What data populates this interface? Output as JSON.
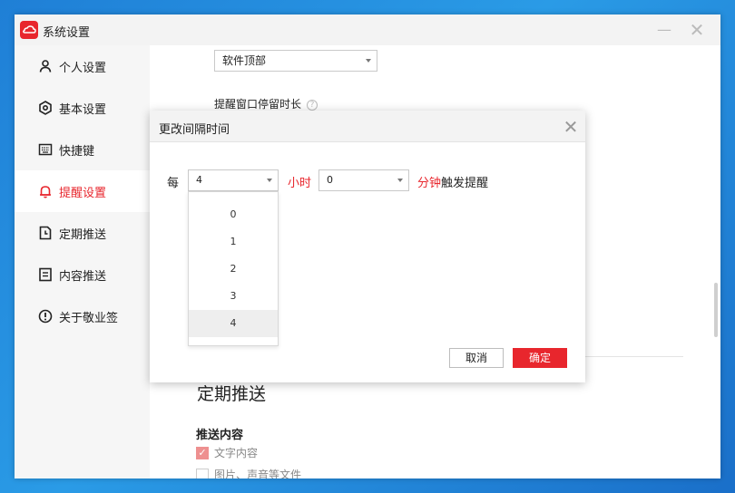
{
  "window": {
    "title": "系统设置",
    "minimize_glyph": "—",
    "close_glyph": "✕"
  },
  "sidebar": {
    "items": [
      {
        "label": "个人设置",
        "icon": "user-icon"
      },
      {
        "label": "基本设置",
        "icon": "gear-icon"
      },
      {
        "label": "快捷键",
        "icon": "keyboard-icon"
      },
      {
        "label": "提醒设置",
        "icon": "bell-icon",
        "active": true
      },
      {
        "label": "定期推送",
        "icon": "calendar-icon"
      },
      {
        "label": "内容推送",
        "icon": "document-icon"
      },
      {
        "label": "关于敬业签",
        "icon": "info-icon"
      }
    ]
  },
  "content": {
    "position_select_value": "软件顶部",
    "stay_duration_label": "提醒窗口停留时长",
    "section_title": "定期推送",
    "push_content_label": "推送内容",
    "checkbox_text": {
      "label": "文字内容",
      "checked": true
    },
    "checkbox_media": {
      "label": "图片、声音等文件",
      "checked": false
    }
  },
  "dialog": {
    "title": "更改间隔时间",
    "close_glyph": "✕",
    "every_label": "每",
    "hours_value": "4",
    "hours_unit": "小时",
    "minutes_value": "0",
    "minutes_unit": "分钟",
    "trigger_label": "触发提醒",
    "hour_options": [
      "0",
      "1",
      "2",
      "3",
      "4"
    ],
    "selected_hour": "4",
    "cancel_label": "取消",
    "ok_label": "确定"
  },
  "colors": {
    "accent": "#e8262d",
    "sidebar_bg": "#f6f6f6",
    "titlebar_bg": "#f3f3f3"
  }
}
